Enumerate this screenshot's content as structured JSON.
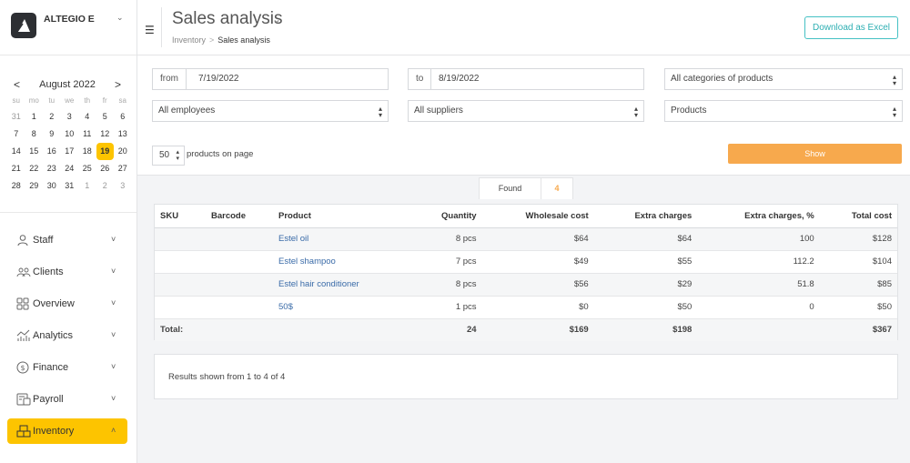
{
  "brand": {
    "name": "ALTEGIO E"
  },
  "calendar": {
    "month_label": "August 2022",
    "prev": "<",
    "next": ">",
    "weekdays": [
      "su",
      "mo",
      "tu",
      "we",
      "th",
      "fr",
      "sa"
    ],
    "weeks": [
      [
        "31",
        "1",
        "2",
        "3",
        "4",
        "5",
        "6"
      ],
      [
        "7",
        "8",
        "9",
        "10",
        "11",
        "12",
        "13"
      ],
      [
        "14",
        "15",
        "16",
        "17",
        "18",
        "19",
        "20"
      ],
      [
        "21",
        "22",
        "23",
        "24",
        "25",
        "26",
        "27"
      ],
      [
        "28",
        "29",
        "30",
        "31",
        "1",
        "2",
        "3"
      ]
    ],
    "selected": "19"
  },
  "sidebar": {
    "items": [
      {
        "label": "Staff",
        "icon": "user-icon"
      },
      {
        "label": "Clients",
        "icon": "group-icon"
      },
      {
        "label": "Overview",
        "icon": "grid-icon"
      },
      {
        "label": "Analytics",
        "icon": "analytics-icon"
      },
      {
        "label": "Finance",
        "icon": "dollar-icon"
      },
      {
        "label": "Payroll",
        "icon": "payroll-icon"
      },
      {
        "label": "Inventory",
        "icon": "boxes-icon",
        "active": true
      }
    ]
  },
  "header": {
    "title": "Sales analysis",
    "breadcrumb": {
      "parent": "Inventory",
      "separator": ">",
      "current": "Sales analysis"
    },
    "download_label": "Download as Excel"
  },
  "filters": {
    "from_label": "from",
    "from_value": "7/19/2022",
    "to_label": "to",
    "to_value": "8/19/2022",
    "category": "All categories of products",
    "employees": "All employees",
    "suppliers": "All suppliers",
    "type": "Products",
    "per_page": "50",
    "per_page_label": "products on page",
    "show_label": "Show"
  },
  "found": {
    "label": "Found",
    "count": "4"
  },
  "table": {
    "headers": [
      "SKU",
      "Barcode",
      "Product",
      "Quantity",
      "Wholesale cost",
      "Extra charges",
      "Extra charges, %",
      "Total cost"
    ],
    "rows": [
      [
        "",
        "",
        "Estel oil",
        "8 pcs",
        "$64",
        "$64",
        "100",
        "$128"
      ],
      [
        "",
        "",
        "Estel shampoo",
        "7 pcs",
        "$49",
        "$55",
        "112.2",
        "$104"
      ],
      [
        "",
        "",
        "Estel hair conditioner",
        "8 pcs",
        "$56",
        "$29",
        "51.8",
        "$85"
      ],
      [
        "",
        "",
        "50$",
        "1 pcs",
        "$0",
        "$50",
        "0",
        "$50"
      ]
    ],
    "total": [
      "Total:",
      "",
      "",
      "24",
      "$169",
      "$198",
      "",
      "$367"
    ]
  },
  "results_text": "Results shown from 1 to 4 of 4",
  "colors": {
    "accent": "#fdc400",
    "show_button": "#f7a94d",
    "excel_button": "#45c1c4",
    "link": "#3a6ba8"
  }
}
